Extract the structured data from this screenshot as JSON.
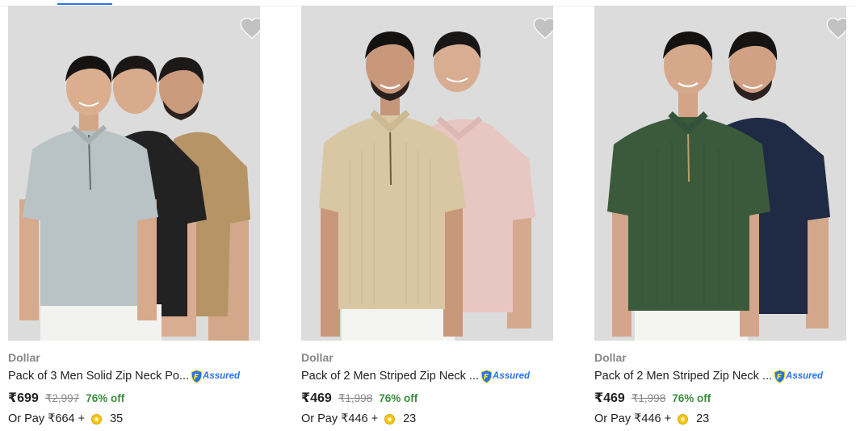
{
  "colors": {
    "accent": "#2874f0",
    "discount": "#388e3c",
    "image_bg": "#dcdcdc",
    "heart": "#c2c2c2"
  },
  "products": [
    {
      "brand": "Dollar",
      "title": "Pack of 3 Men Solid Zip Neck Po...",
      "assured_label": "Assured",
      "price": "₹699",
      "mrp": "₹2,997",
      "discount": "76% off",
      "pay_label": "Or Pay ₹664 +",
      "coins": "35",
      "icon": "heart-icon",
      "shirt_colors": [
        "#b79466",
        "#222222",
        "#b9c3c6"
      ]
    },
    {
      "brand": "Dollar",
      "title": "Pack of 2 Men Striped Zip Neck ...",
      "assured_label": "Assured",
      "price": "₹469",
      "mrp": "₹1,998",
      "discount": "76% off",
      "pay_label": "Or Pay ₹446 +",
      "coins": "23",
      "icon": "heart-icon",
      "shirt_colors": [
        "#e8c6c2",
        "#d9c7a3"
      ]
    },
    {
      "brand": "Dollar",
      "title": "Pack of 2 Men Striped Zip Neck ...",
      "assured_label": "Assured",
      "price": "₹469",
      "mrp": "₹1,998",
      "discount": "76% off",
      "pay_label": "Or Pay ₹446 +",
      "coins": "23",
      "icon": "heart-icon",
      "shirt_colors": [
        "#1f2a44",
        "#3b5a3c"
      ]
    }
  ]
}
